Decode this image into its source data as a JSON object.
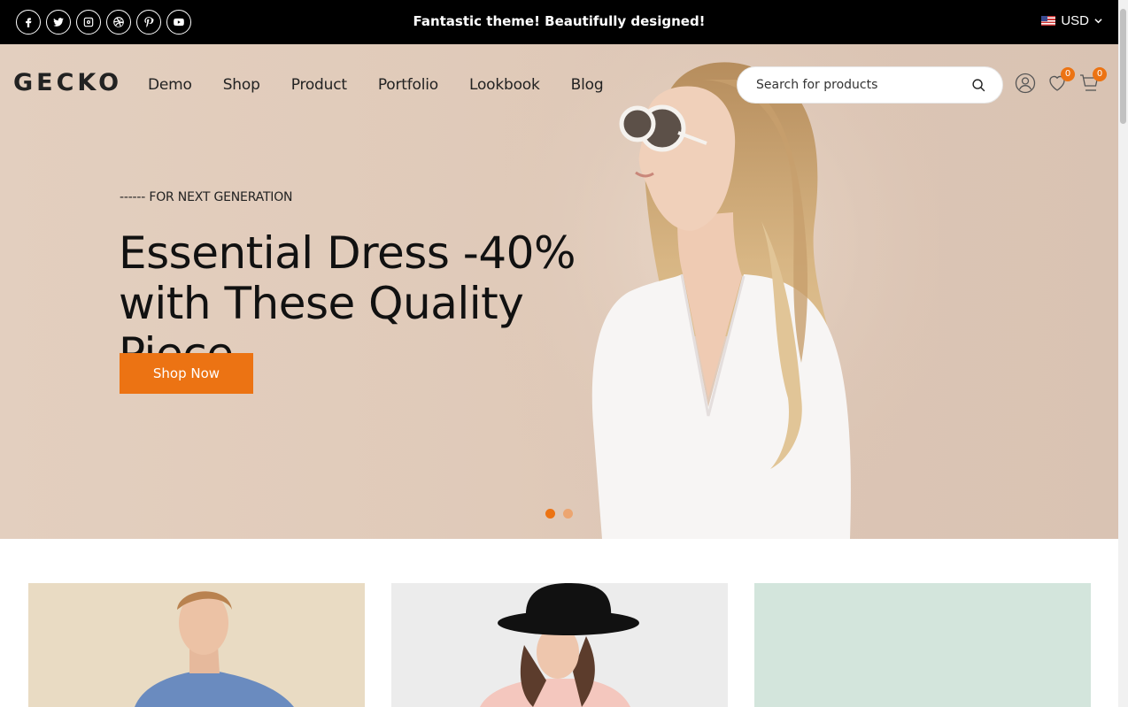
{
  "topbar": {
    "social": [
      {
        "name": "facebook-icon",
        "glyph": "f"
      },
      {
        "name": "twitter-icon",
        "glyph": "t"
      },
      {
        "name": "instagram-icon",
        "glyph": "i"
      },
      {
        "name": "dribbble-icon",
        "glyph": "d"
      },
      {
        "name": "pinterest-icon",
        "glyph": "p"
      },
      {
        "name": "youtube-icon",
        "glyph": "y"
      }
    ],
    "promo_text": "Fantastic theme! Beautifully designed!",
    "currency": "USD"
  },
  "header": {
    "logo": "GECKO",
    "nav": [
      "Demo",
      "Shop",
      "Product",
      "Portfolio",
      "Lookbook",
      "Blog"
    ],
    "search_placeholder": "Search for products",
    "wishlist_count": "0",
    "cart_count": "0"
  },
  "hero": {
    "subtitle": "------ FOR NEXT GENERATION",
    "headline_line1": "Essential Dress -40%",
    "headline_line2": "with These Quality Piece.",
    "cta_label": "Shop Now",
    "slides": 2,
    "active_slide": 1
  },
  "colors": {
    "accent": "#ec7313",
    "hero_bg": "#e0cab9",
    "card1_bg": "#e9dbc3",
    "card2_bg": "#ececec",
    "card3_bg": "#d3e5dc"
  }
}
